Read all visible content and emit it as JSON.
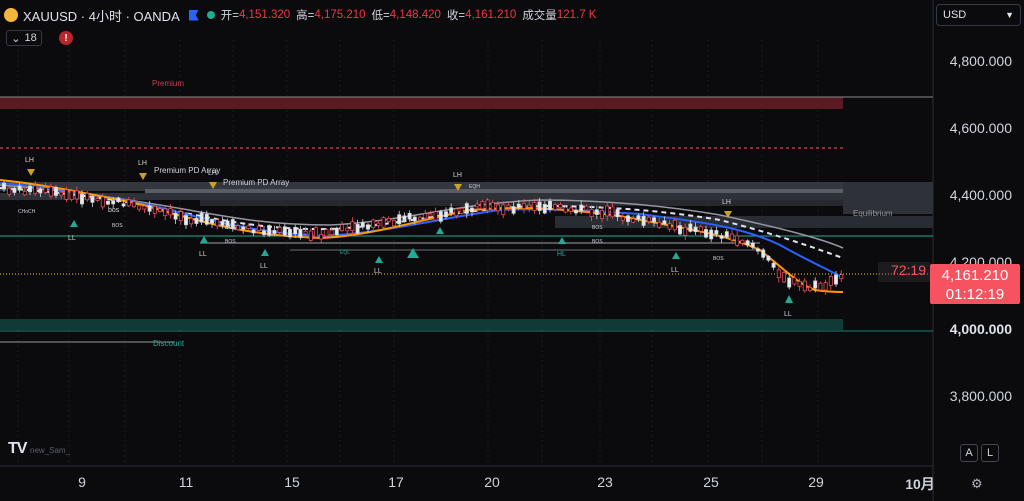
{
  "header": {
    "symbol": "XAUUSD · 4小时 · OANDA",
    "open_label": "开=",
    "open": "4,151.320",
    "high_label": "高=",
    "high": "4,175.210",
    "low_label": "低=",
    "low": "4,148.420",
    "close_label": "收=",
    "close": "4,161.210",
    "volume_label": "成交量",
    "volume": "121.7 K"
  },
  "indicators": {
    "count": "18"
  },
  "currency": {
    "selected": "USD"
  },
  "price_axis": {
    "labels": [
      "4,800.000",
      "4,600.000",
      "4,400.000",
      "4,200.000",
      "4,000.000",
      "3,800.000"
    ]
  },
  "time_axis": {
    "labels": [
      "9",
      "11",
      "15",
      "17",
      "20",
      "23",
      "25",
      "29",
      "10月"
    ]
  },
  "last_price": {
    "value": "4,161.210",
    "timer": "01:12:19",
    "countdown": "72:19"
  },
  "zones": {
    "premium": "Premium",
    "discount": "Discount",
    "equilibrium": "Equilibrium",
    "pd1": "Premium PD Array",
    "pd2": "Premium PD Array"
  },
  "structure_labels": {
    "lh1": "LH",
    "lh2": "LH",
    "lh3": "LH",
    "lh4": "LH",
    "lh5": "LH",
    "ll1": "LL",
    "ll2": "LL",
    "ll3": "LL",
    "ll4": "LL",
    "ll5": "LL",
    "hl": "HL",
    "bos": "bos",
    "BOS": "BOS",
    "choch": "CHoCH",
    "eql": "EQL",
    "eqh": "EQH"
  },
  "footer": {
    "auto": "A",
    "log": "L",
    "logo": "TV",
    "user": "new_Sam_"
  },
  "colors": {
    "bear": "#f23645",
    "bull": "#22ab94",
    "premium_zone": "#5a1a22",
    "discount_zone": "#0f3a36",
    "ema_fast": "#ff9800",
    "ema_slow": "#2962ff",
    "accent": "#f7525f"
  }
}
